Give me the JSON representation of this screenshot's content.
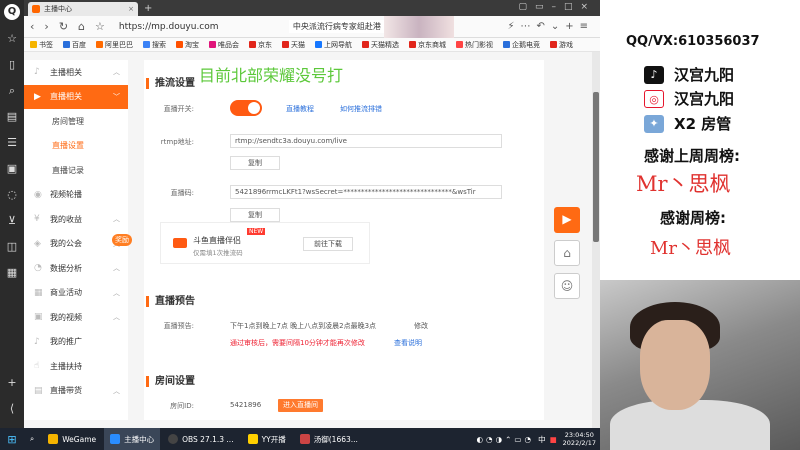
{
  "browser": {
    "tab_title": "主播中心",
    "url": "https://mp.douyu.com",
    "news": "中央派流行病专家组赴港",
    "bookmarks": [
      "书签",
      "百度",
      "阿里巴巴",
      "搜索",
      "淘宝",
      "唯品会",
      "京东",
      "天猫",
      "上网导航",
      "天猫精选",
      "京东商城",
      "热门影视",
      "企鹅电竞",
      "游戏"
    ]
  },
  "sidebar": {
    "items": [
      {
        "label": "主播相关",
        "icon": "mic-icon"
      },
      {
        "label": "直播相关",
        "icon": "video-icon",
        "active": true
      },
      {
        "label": "房间管理",
        "sub": true
      },
      {
        "label": "直播设置",
        "sub": true,
        "selected": true
      },
      {
        "label": "直播记录",
        "sub": true
      },
      {
        "label": "视频轮播",
        "icon": "carousel-icon"
      },
      {
        "label": "我的收益",
        "icon": "income-icon"
      },
      {
        "label": "我的公会",
        "icon": "guild-icon"
      },
      {
        "label": "数据分析",
        "icon": "chart-icon"
      },
      {
        "label": "商业活动",
        "icon": "business-icon"
      },
      {
        "label": "我的视频",
        "icon": "my-video-icon"
      },
      {
        "label": "我的推广",
        "icon": "promo-icon"
      },
      {
        "label": "主播扶持",
        "icon": "support-icon"
      },
      {
        "label": "直播带货",
        "icon": "shop-icon"
      }
    ],
    "badge": "奖励"
  },
  "main": {
    "watermark": "目前北部荣耀没号打",
    "push_title": "推流设置",
    "live_switch_label": "直播开关:",
    "tutorial_link": "直播教程",
    "troubleshoot_link": "如何推流排错",
    "rtmp_label": "rtmp地址:",
    "rtmp_value": "rtmp://sendtc3a.douyu.com/live",
    "copy_label": "复制",
    "code_label": "直播码:",
    "code_value": "5421896rrmcLKFt1?wsSecret=*******************************&wsTir",
    "companion_title": "斗鱼直播伴侣",
    "companion_sub": "仅需填1次推流码",
    "companion_new": "NEW",
    "download_label": "前往下载",
    "preview_title": "直播预告",
    "preview_label": "直播预告:",
    "preview_value": "下午1点到晚上7点 晚上八点到凌晨2点最晚3点",
    "modify_label": "修改",
    "preview_notice": "通过审核后，需要间隔10分钟才能再次修改",
    "view_desc": "查看说明",
    "room_title": "房间设置",
    "room_id_label": "房间ID:",
    "room_id_value": "5421896",
    "enter_room": "进入直播间"
  },
  "taskbar": {
    "items": [
      "WeGame",
      "主播中心",
      "OBS 27.1.3 ...",
      "YY开播",
      "汤御(1663..."
    ],
    "ime": "中",
    "time": "23:04:50",
    "date": "2022/2/17"
  },
  "overlay": {
    "contact": "QQ/VX:610356037",
    "douyin": "汉宫九阳",
    "weibo": "汉宫九阳",
    "admin": "X2 房管",
    "last_week_title": "感谢上周周榜:",
    "last_week_name": "Mr丶思枫",
    "this_week_title": "感谢周榜:",
    "this_week_name": "Mr丶思枫"
  },
  "colors": {
    "accent": "#ff6a13",
    "overlay_red": "#e0322f",
    "watermark_green": "#5cc83a"
  }
}
